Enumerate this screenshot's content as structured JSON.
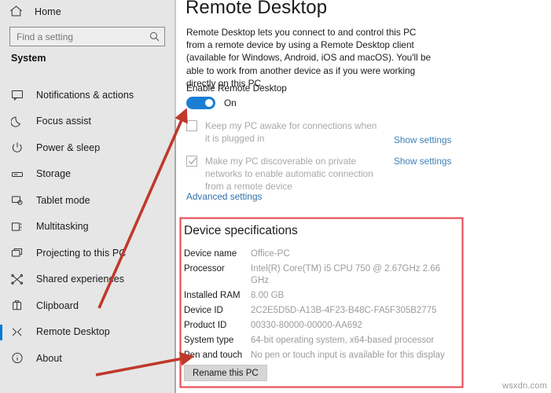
{
  "sidebar": {
    "home_label": "Home",
    "home_icon": "home-icon",
    "search": {
      "placeholder": "Find a setting",
      "value": "",
      "icon": "search-icon"
    },
    "section_title": "System",
    "items": [
      {
        "label": "Notifications & actions",
        "icon": "notification-bubble-icon",
        "selected": false
      },
      {
        "label": "Focus assist",
        "icon": "moon-icon",
        "selected": false
      },
      {
        "label": "Power & sleep",
        "icon": "power-icon",
        "selected": false
      },
      {
        "label": "Storage",
        "icon": "storage-drive-icon",
        "selected": false
      },
      {
        "label": "Tablet mode",
        "icon": "tablet-icon",
        "selected": false
      },
      {
        "label": "Multitasking",
        "icon": "multitasking-icon",
        "selected": false
      },
      {
        "label": "Projecting to this PC",
        "icon": "projecting-icon",
        "selected": false
      },
      {
        "label": "Shared experiences",
        "icon": "shared-experiences-icon",
        "selected": false
      },
      {
        "label": "Clipboard",
        "icon": "clipboard-icon",
        "selected": false
      },
      {
        "label": "Remote Desktop",
        "icon": "remote-desktop-icon",
        "selected": true
      },
      {
        "label": "About",
        "icon": "info-circle-icon",
        "selected": false
      }
    ]
  },
  "main": {
    "title": "Remote Desktop",
    "description": "Remote Desktop lets you connect to and control this PC from a remote device by using a Remote Desktop client (available for Windows, Android, iOS and macOS). You'll be able to work from another device as if you were working directly on this PC.",
    "enable_label": "Enable Remote Desktop",
    "toggle_state": "On",
    "toggle_on": true,
    "options": [
      {
        "label": "Keep my PC awake for connections when it is plugged in",
        "checked": false,
        "link": "Show settings"
      },
      {
        "label": "Make my PC discoverable on private networks to enable automatic connection from a remote device",
        "checked": true,
        "link": "Show settings"
      }
    ],
    "advanced_link": "Advanced settings"
  },
  "device_specifications": {
    "title": "Device specifications",
    "rows": [
      {
        "key": "Device name",
        "value": "Office-PC"
      },
      {
        "key": "Processor",
        "value": "Intel(R) Core(TM) i5 CPU         750  @ 2.67GHz  2.66 GHz"
      },
      {
        "key": "Installed RAM",
        "value": "8.00 GB"
      },
      {
        "key": "Device ID",
        "value": "2C2E5D5D-A13B-4F23-B48C-FA5F305B2775"
      },
      {
        "key": "Product ID",
        "value": "00330-80000-00000-AA692"
      },
      {
        "key": "System type",
        "value": "64-bit operating system, x64-based processor"
      },
      {
        "key": "Pen and touch",
        "value": "No pen or touch input is available for this display"
      }
    ],
    "rename_button": "Rename this PC"
  },
  "annotations": {
    "highlight_color": "#e8505a",
    "arrow_color": "#c0392b",
    "arrow_count": 2,
    "highlight_box": "device-specifications"
  },
  "watermark": "wsxdn.com",
  "colors": {
    "accent": "#0078d7",
    "toggle_on": "#1a7fd4",
    "link": "#3f80b7",
    "sidebar_bg": "#e6e6e6",
    "content_bg": "#ffffff",
    "muted_text": "#9b9b9b"
  }
}
